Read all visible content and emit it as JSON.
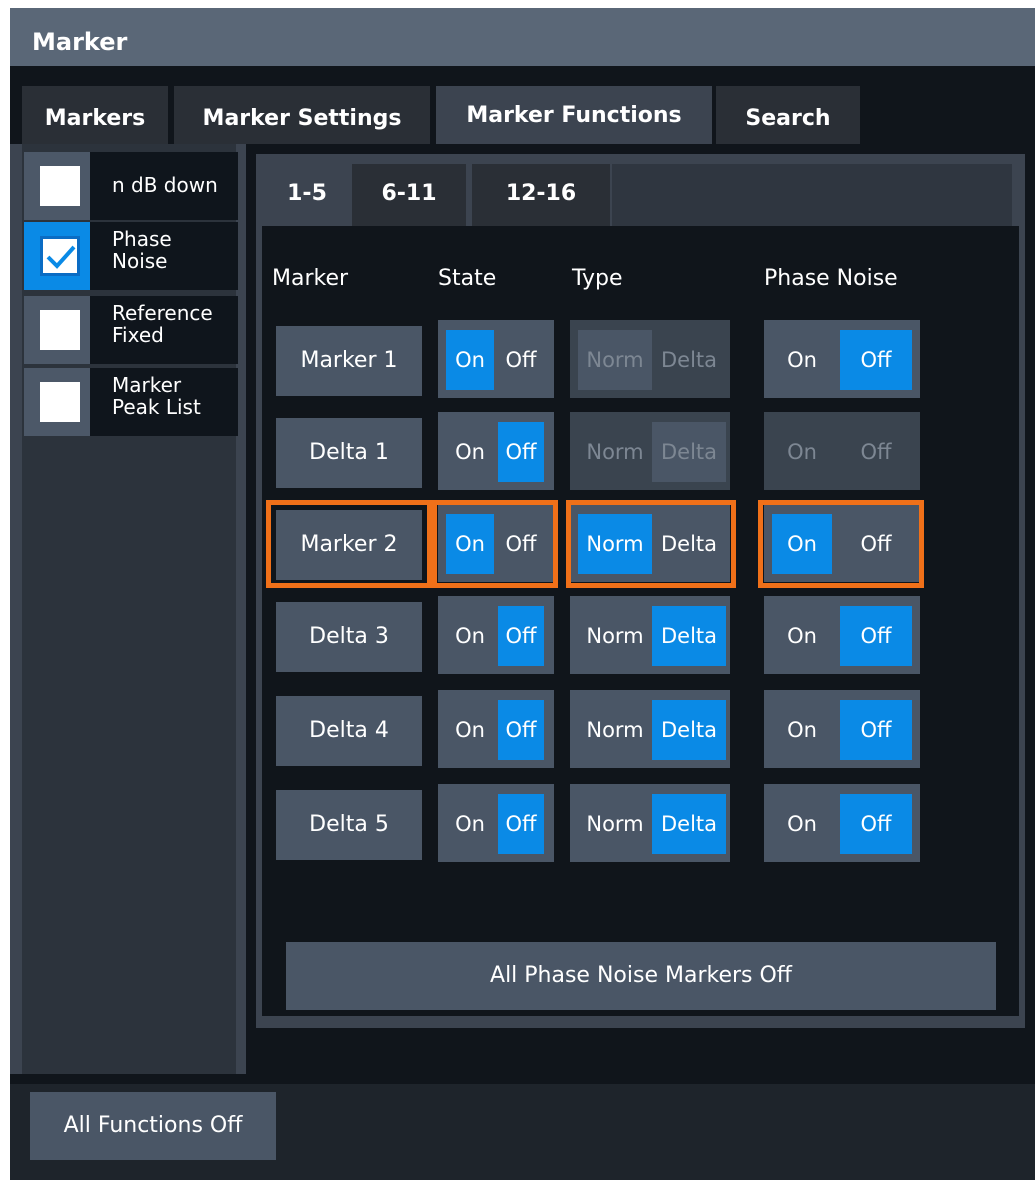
{
  "window": {
    "title": "Marker"
  },
  "main_tabs": [
    {
      "label": "Markers",
      "active": false
    },
    {
      "label": "Marker Settings",
      "active": false
    },
    {
      "label": "Marker Functions",
      "active": true
    },
    {
      "label": "Search",
      "active": false
    }
  ],
  "functions": [
    {
      "label": "n dB down",
      "checked": false
    },
    {
      "label": "Phase\nNoise",
      "checked": true
    },
    {
      "label": "Reference\nFixed",
      "checked": false
    },
    {
      "label": "Marker\nPeak List",
      "checked": false
    }
  ],
  "sub_tabs": [
    {
      "label": "1-5",
      "active": true
    },
    {
      "label": "6-11",
      "active": false
    },
    {
      "label": "12-16",
      "active": false
    }
  ],
  "columns": {
    "marker": "Marker",
    "state": "State",
    "type": "Type",
    "phase_noise": "Phase Noise"
  },
  "toggle_labels": {
    "on": "On",
    "off": "Off",
    "norm": "Norm",
    "delta": "Delta"
  },
  "rows": [
    {
      "marker": "Marker 1",
      "state": "On",
      "type": "Norm",
      "type_enabled": false,
      "phase_noise": "Off",
      "pn_enabled": true,
      "highlighted": false
    },
    {
      "marker": "Delta 1",
      "state": "Off",
      "type": "Delta",
      "type_enabled": false,
      "phase_noise": "Off",
      "pn_enabled": false,
      "highlighted": false
    },
    {
      "marker": "Marker 2",
      "state": "On",
      "type": "Norm",
      "type_enabled": true,
      "phase_noise": "On",
      "pn_enabled": true,
      "highlighted": true
    },
    {
      "marker": "Delta 3",
      "state": "Off",
      "type": "Delta",
      "type_enabled": true,
      "phase_noise": "Off",
      "pn_enabled": true,
      "highlighted": false
    },
    {
      "marker": "Delta 4",
      "state": "Off",
      "type": "Delta",
      "type_enabled": true,
      "phase_noise": "Off",
      "pn_enabled": true,
      "highlighted": false
    },
    {
      "marker": "Delta 5",
      "state": "Off",
      "type": "Delta",
      "type_enabled": true,
      "phase_noise": "Off",
      "pn_enabled": true,
      "highlighted": false
    }
  ],
  "all_phase_noise_off": "All Phase Noise Markers Off",
  "all_functions_off": "All Functions Off",
  "colors": {
    "accent": "#0a8ae6",
    "highlight": "#f07019",
    "button": "#4a5666",
    "panel": "#3c4450"
  }
}
